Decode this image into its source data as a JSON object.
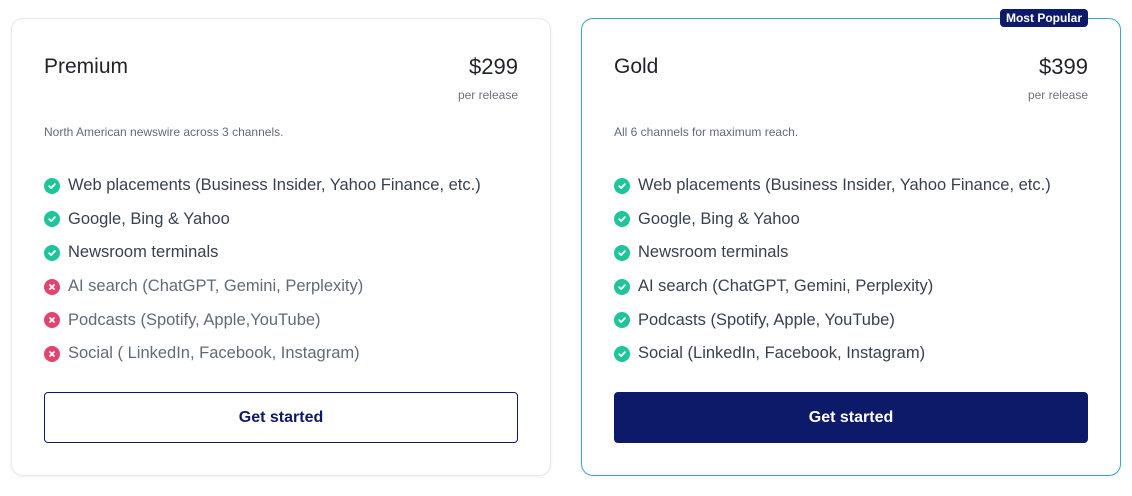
{
  "colors": {
    "brand_navy": "#0d1a6a",
    "accent_border": "#38a7c9",
    "check_green": "#1fc49a",
    "cross_red": "#e0456d"
  },
  "plans": [
    {
      "name": "Premium",
      "price": "$299",
      "price_unit": "per release",
      "description": "North American newswire across 3 channels.",
      "features": [
        {
          "label": "Web placements (Business Insider, Yahoo Finance, etc.)",
          "included": true,
          "icon": "check-circle-icon"
        },
        {
          "label": "Google, Bing & Yahoo",
          "included": true,
          "icon": "check-circle-icon"
        },
        {
          "label": "Newsroom terminals",
          "included": true,
          "icon": "check-circle-icon"
        },
        {
          "label": "AI search (ChatGPT, Gemini, Perplexity)",
          "included": false,
          "icon": "x-circle-icon"
        },
        {
          "label": "Podcasts (Spotify, Apple,YouTube)",
          "included": false,
          "icon": "x-circle-icon"
        },
        {
          "label": "Social ( LinkedIn, Facebook, Instagram)",
          "included": false,
          "icon": "x-circle-icon"
        }
      ],
      "cta_label": "Get started"
    },
    {
      "name": "Gold",
      "badge": "Most Popular",
      "price": "$399",
      "price_unit": "per release",
      "description": "All 6 channels for maximum reach.",
      "features": [
        {
          "label": "Web placements (Business Insider, Yahoo Finance, etc.)",
          "included": true,
          "icon": "check-circle-icon"
        },
        {
          "label": "Google, Bing & Yahoo",
          "included": true,
          "icon": "check-circle-icon"
        },
        {
          "label": "Newsroom terminals",
          "included": true,
          "icon": "check-circle-icon"
        },
        {
          "label": "AI search (ChatGPT, Gemini, Perplexity)",
          "included": true,
          "icon": "check-circle-icon"
        },
        {
          "label": "Podcasts (Spotify, Apple, YouTube)",
          "included": true,
          "icon": "check-circle-icon"
        },
        {
          "label": "Social (LinkedIn, Facebook, Instagram)",
          "included": true,
          "icon": "check-circle-icon"
        }
      ],
      "cta_label": "Get started"
    }
  ]
}
